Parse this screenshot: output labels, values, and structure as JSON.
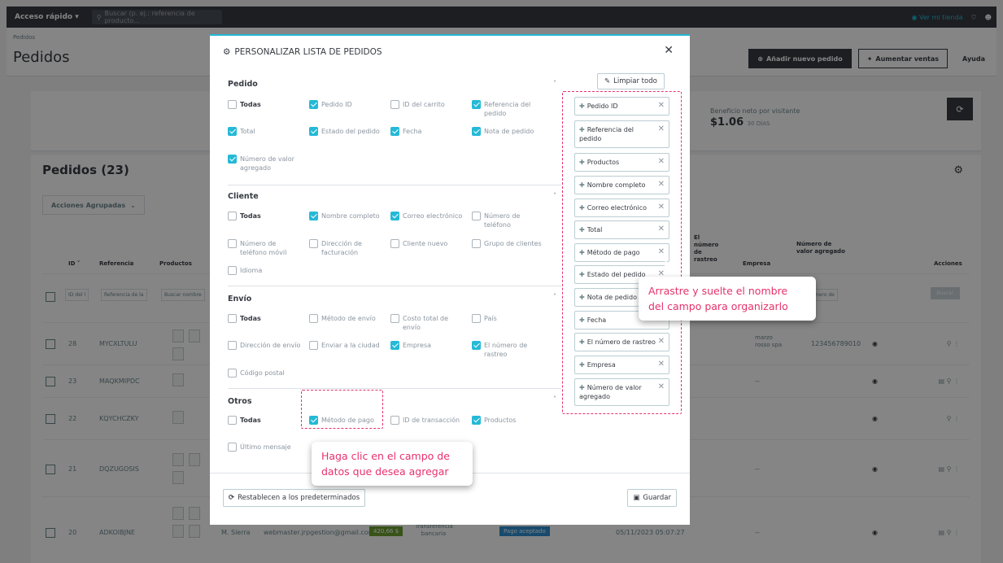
{
  "topbar": {
    "quick_access": "Acceso rápido ▾",
    "search_placeholder": "Buscar (p. ej.: referencia de producto...",
    "view_store": "Ver mi tienda"
  },
  "header": {
    "breadcrumb": "Pedidos",
    "title": "Pedidos",
    "add_order": "Añadir nuevo pedido",
    "boost_sales": "Aumentar ventas",
    "help": "Ayuda"
  },
  "kpi": {
    "label": "Beneficio neto por visitante",
    "value": "$1.06",
    "period": "30 DÍAS"
  },
  "orders": {
    "title": "Pedidos (23)",
    "bulk_actions": "Acciones Agrupadas",
    "columns": {
      "id": "ID",
      "reference": "Referencia",
      "products": "Productos",
      "tracking": "El número de rastreo",
      "company": "Empresa",
      "vat": "Número de valor agregado",
      "actions": "Acciones"
    },
    "filters": {
      "id": "ID del l",
      "reference": "Referencia de la",
      "products": "Buscar nombre",
      "vat": "el número de",
      "search": "Buscar"
    },
    "rows": [
      {
        "id": "28",
        "ref": "MYCXLTULU",
        "company": "marzo rosso spa",
        "vat": "123456789010"
      },
      {
        "id": "23",
        "ref": "MAQKMIPDC",
        "company": "--",
        "vat": ""
      },
      {
        "id": "22",
        "ref": "KQYCHCZKY",
        "company": "",
        "vat": ""
      },
      {
        "id": "21",
        "ref": "DQZUGOSIS",
        "company": "--",
        "vat": ""
      },
      {
        "id": "20",
        "ref": "ADKOIBJNE",
        "customer": "M. Sierra",
        "email": "webmaster.jrpgestion@gmail.com",
        "total": "420,66 $",
        "payment": "Transferencia bancaria",
        "status": "Pago aceptado",
        "date": "05/11/2023 05:07:27",
        "company": "--"
      }
    ]
  },
  "modal": {
    "title": "PERSONALIZAR LISTA DE PEDIDOS",
    "clear_all": "Limpiar todo",
    "reset": "Restablecen a los predeterminados",
    "save": "Guardar",
    "sections": [
      {
        "title": "Pedido",
        "options": [
          {
            "label": "Todas",
            "checked": false,
            "bold": true
          },
          {
            "label": "Pedido ID",
            "checked": true
          },
          {
            "label": "ID del carrito",
            "checked": false
          },
          {
            "label": "Referencia del pedido",
            "checked": true
          },
          {
            "label": "Total",
            "checked": true
          },
          {
            "label": "Estado del pedido",
            "checked": true
          },
          {
            "label": "Fecha",
            "checked": true
          },
          {
            "label": "Nota de pedido",
            "checked": true
          },
          {
            "label": "Número de valor agregado",
            "checked": true
          }
        ]
      },
      {
        "title": "Cliente",
        "options": [
          {
            "label": "Todas",
            "checked": false,
            "bold": true
          },
          {
            "label": "Nombre completo",
            "checked": true
          },
          {
            "label": "Correo electrónico",
            "checked": true
          },
          {
            "label": "Número de teléfono",
            "checked": false
          },
          {
            "label": "Número de teléfono móvil",
            "checked": false
          },
          {
            "label": "Dirección de facturación",
            "checked": false
          },
          {
            "label": "Cliente nuevo",
            "checked": false
          },
          {
            "label": "Grupo de clientes",
            "checked": false
          },
          {
            "label": "Idioma",
            "checked": false
          }
        ]
      },
      {
        "title": "Envío",
        "options": [
          {
            "label": "Todas",
            "checked": false,
            "bold": true
          },
          {
            "label": "Método de envío",
            "checked": false
          },
          {
            "label": "Costo total de envío",
            "checked": false
          },
          {
            "label": "País",
            "checked": false
          },
          {
            "label": "Dirección de envío",
            "checked": false
          },
          {
            "label": "Enviar a la ciudad",
            "checked": false
          },
          {
            "label": "Empresa",
            "checked": true
          },
          {
            "label": "El número de rastreo",
            "checked": true
          },
          {
            "label": "Código postal",
            "checked": false
          }
        ]
      },
      {
        "title": "Otros",
        "options": [
          {
            "label": "Todas",
            "checked": false,
            "bold": true
          },
          {
            "label": "Método de pago",
            "checked": true
          },
          {
            "label": "ID de transacción",
            "checked": false
          },
          {
            "label": "Productos",
            "checked": true
          },
          {
            "label": "Último mensaje",
            "checked": false
          }
        ]
      }
    ],
    "selected": [
      "Pedido ID",
      "Referencia del pedido",
      "Productos",
      "Nombre completo",
      "Correo electrónico",
      "Total",
      "Método de pago",
      "Estado del pedido",
      "Nota de pedido",
      "Fecha",
      "El número de rastreo",
      "Empresa",
      "Número de valor agregado"
    ]
  },
  "annotations": {
    "drag_tip": "Arrastre y suelte el nombre del campo para organizarlo",
    "click_tip": "Haga clic en el campo de datos que desea agregar",
    "accent_color": "#e6316c"
  }
}
